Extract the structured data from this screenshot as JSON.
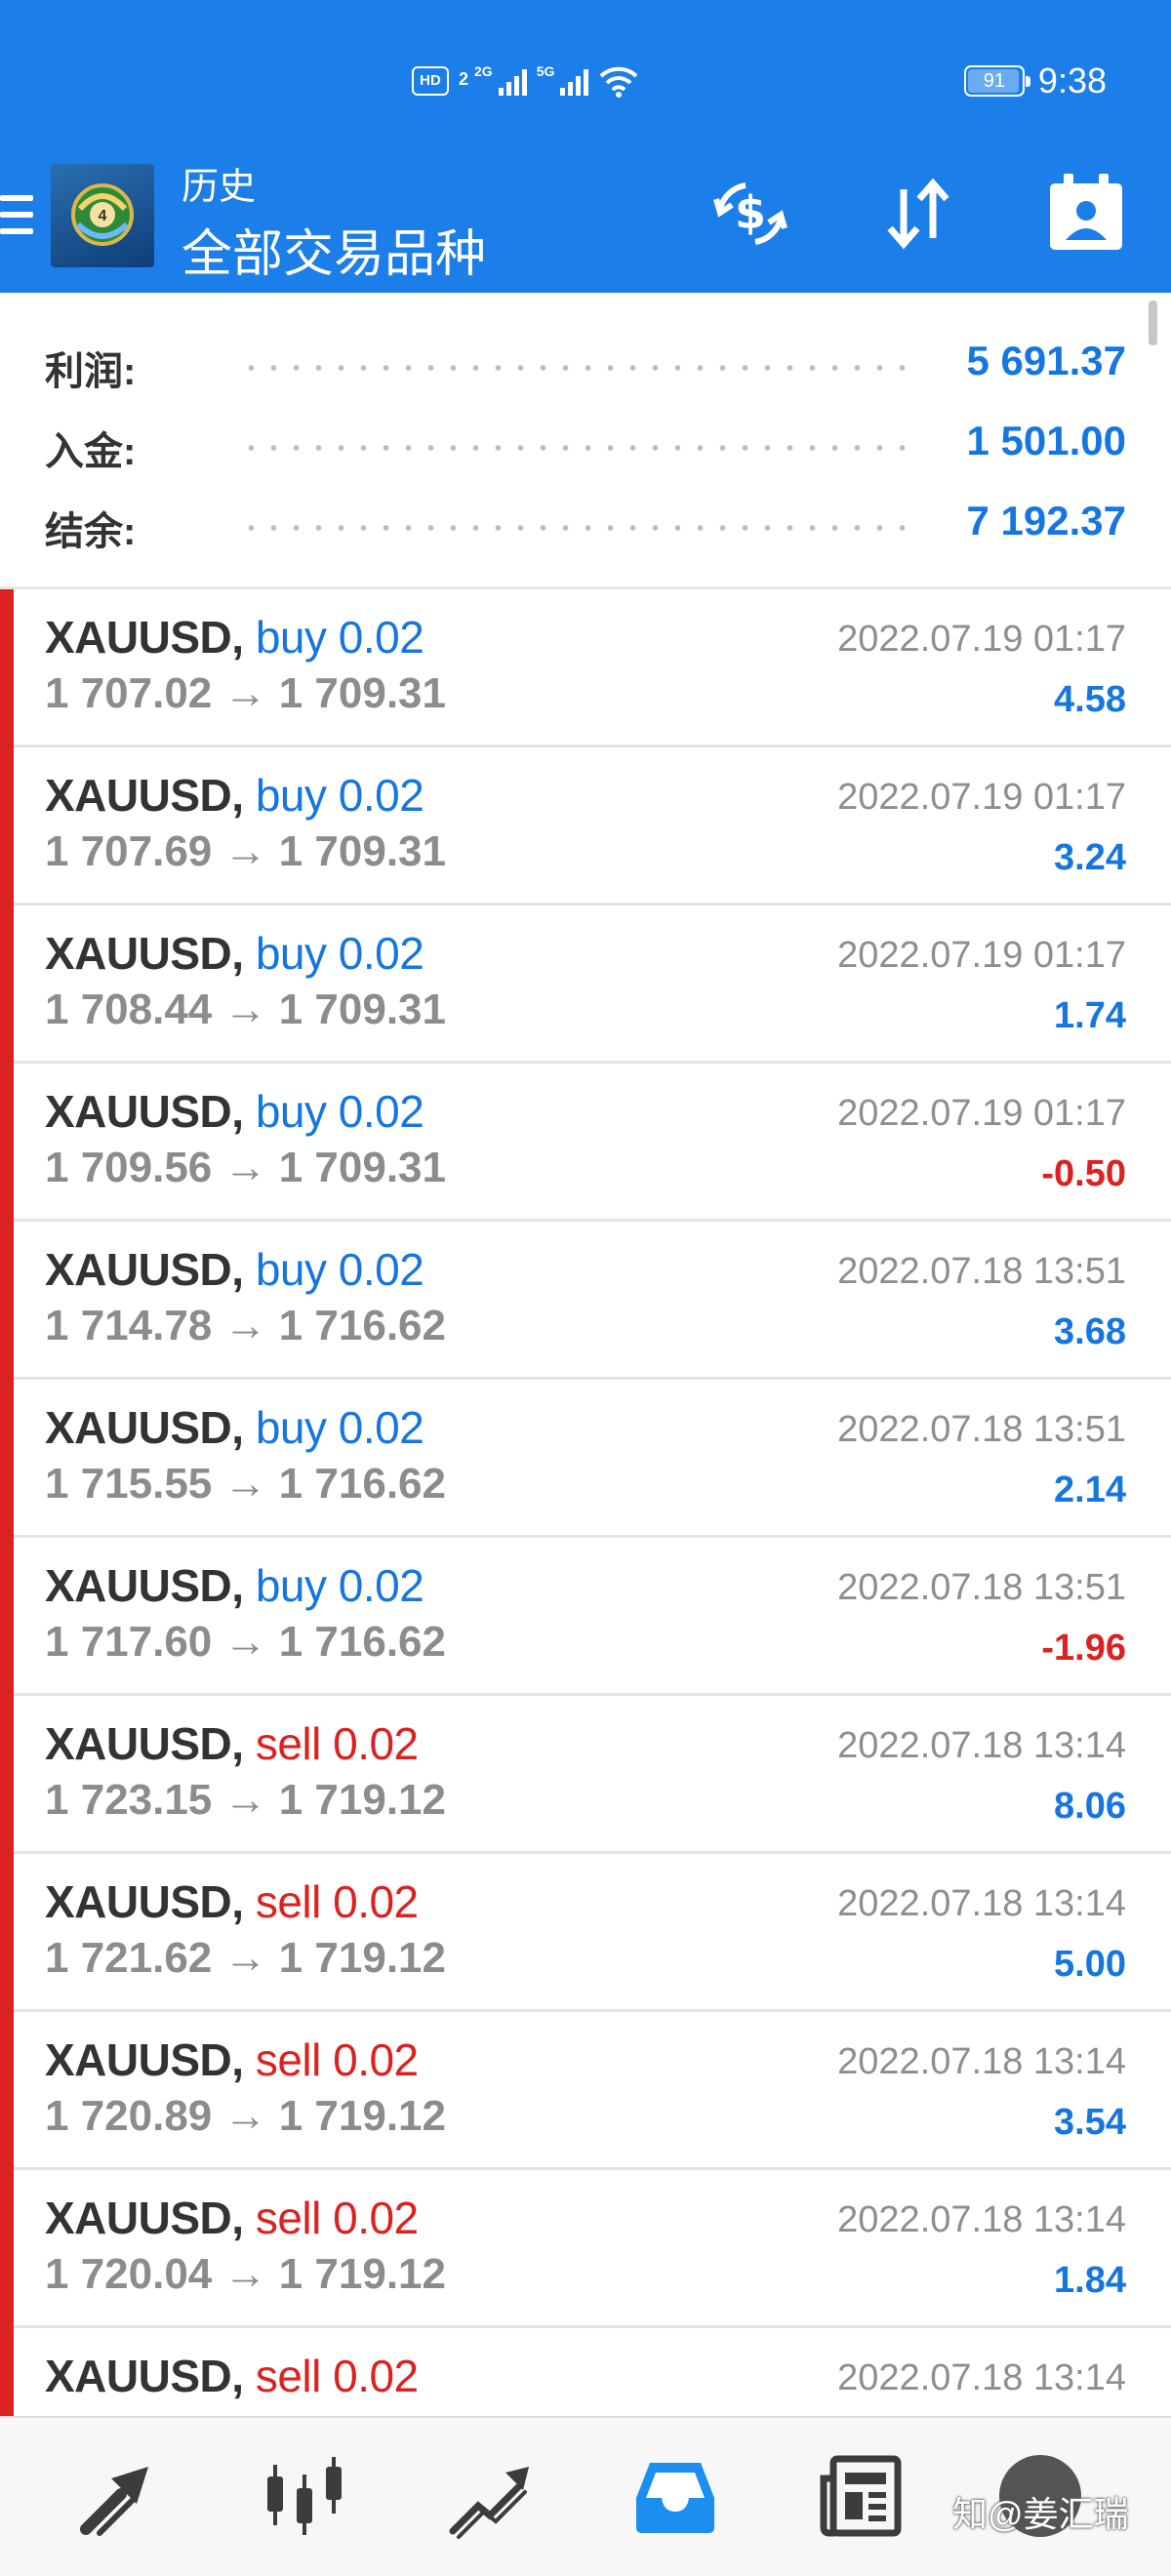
{
  "status_bar": {
    "hd_label": "HD",
    "sim_label": "2",
    "network1": "2G",
    "network2": "5G",
    "battery": "91",
    "time": "9:38"
  },
  "toolbar": {
    "title": "历史",
    "subtitle": "全部交易品种",
    "menu_icon": "hamburger-icon",
    "currency_icon": "currency-exchange-icon",
    "sort_icon": "sort-icon",
    "calendar_icon": "calendar-person-icon"
  },
  "summary": {
    "profit_label": "利润:",
    "profit_value": "5 691.37",
    "deposit_label": "入金:",
    "deposit_value": "1 501.00",
    "balance_label": "结余:",
    "balance_value": "7 192.37"
  },
  "deals": [
    {
      "symbol": "XAUUSD,",
      "type": "buy 0.02",
      "side": "buy",
      "prices": "1 707.02 → 1 709.31",
      "time": "2022.07.19 01:17",
      "profit": "4.58"
    },
    {
      "symbol": "XAUUSD,",
      "type": "buy 0.02",
      "side": "buy",
      "prices": "1 707.69 → 1 709.31",
      "time": "2022.07.19 01:17",
      "profit": "3.24"
    },
    {
      "symbol": "XAUUSD,",
      "type": "buy 0.02",
      "side": "buy",
      "prices": "1 708.44 → 1 709.31",
      "time": "2022.07.19 01:17",
      "profit": "1.74"
    },
    {
      "symbol": "XAUUSD,",
      "type": "buy 0.02",
      "side": "buy",
      "prices": "1 709.56 → 1 709.31",
      "time": "2022.07.19 01:17",
      "profit": "-0.50"
    },
    {
      "symbol": "XAUUSD,",
      "type": "buy 0.02",
      "side": "buy",
      "prices": "1 714.78 → 1 716.62",
      "time": "2022.07.18 13:51",
      "profit": "3.68"
    },
    {
      "symbol": "XAUUSD,",
      "type": "buy 0.02",
      "side": "buy",
      "prices": "1 715.55 → 1 716.62",
      "time": "2022.07.18 13:51",
      "profit": "2.14"
    },
    {
      "symbol": "XAUUSD,",
      "type": "buy 0.02",
      "side": "buy",
      "prices": "1 717.60 → 1 716.62",
      "time": "2022.07.18 13:51",
      "profit": "-1.96"
    },
    {
      "symbol": "XAUUSD,",
      "type": "sell 0.02",
      "side": "sell",
      "prices": "1 723.15 → 1 719.12",
      "time": "2022.07.18 13:14",
      "profit": "8.06"
    },
    {
      "symbol": "XAUUSD,",
      "type": "sell 0.02",
      "side": "sell",
      "prices": "1 721.62 → 1 719.12",
      "time": "2022.07.18 13:14",
      "profit": "5.00"
    },
    {
      "symbol": "XAUUSD,",
      "type": "sell 0.02",
      "side": "sell",
      "prices": "1 720.89 → 1 719.12",
      "time": "2022.07.18 13:14",
      "profit": "3.54"
    },
    {
      "symbol": "XAUUSD,",
      "type": "sell 0.02",
      "side": "sell",
      "prices": "1 720.04 → 1 719.12",
      "time": "2022.07.18 13:14",
      "profit": "1.84"
    },
    {
      "symbol": "XAUUSD,",
      "type": "sell 0.02",
      "side": "sell",
      "prices": "",
      "time": "2022.07.18 13:14",
      "profit": ""
    }
  ],
  "bottom_nav": [
    {
      "name": "quotes",
      "icon": "quotes-arrows-icon",
      "active": false
    },
    {
      "name": "chart",
      "icon": "candlestick-icon",
      "active": false
    },
    {
      "name": "trade",
      "icon": "trade-trend-icon",
      "active": false
    },
    {
      "name": "history",
      "icon": "inbox-tray-icon",
      "active": true
    },
    {
      "name": "news",
      "icon": "newspaper-icon",
      "active": false
    }
  ],
  "watermark": "知@姜汇瑞",
  "colors": {
    "header": "#1c7ee8",
    "accent_blue": "#1676e0",
    "accent_red": "#dc2121",
    "nav_active": "#1c8ef0",
    "nav_inactive": "#3c3c3c"
  }
}
